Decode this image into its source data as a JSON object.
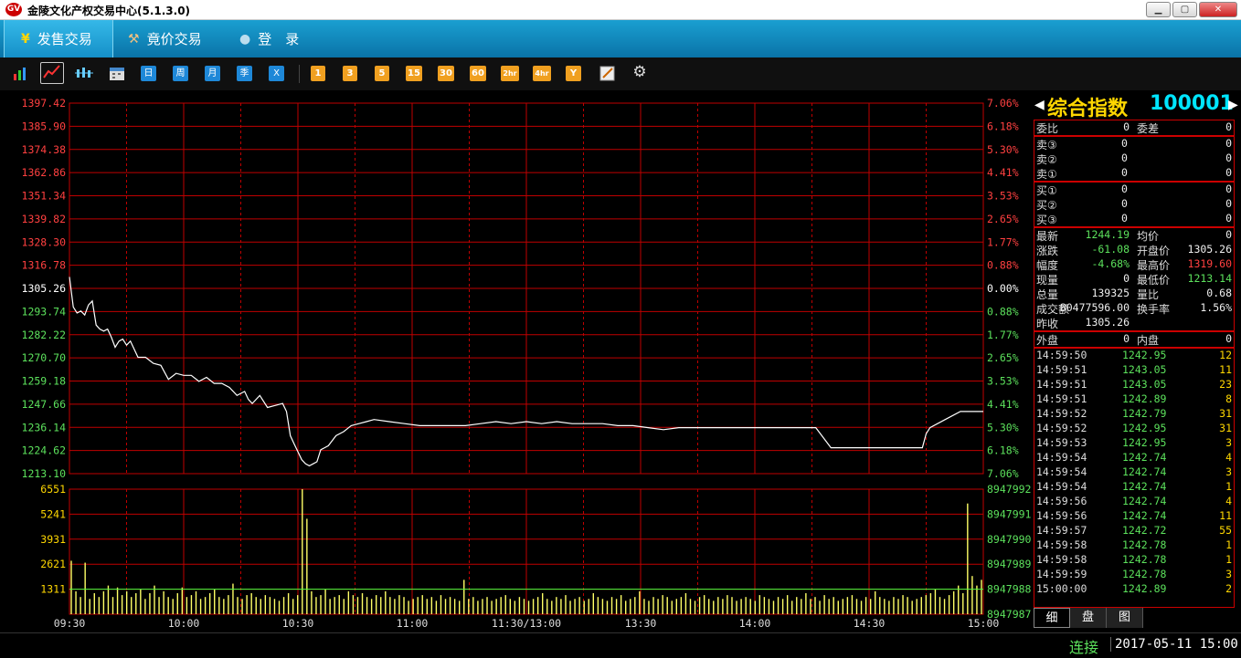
{
  "window": {
    "title": "金陵文化产权交易中心(5.1.3.0)",
    "logo": "GV"
  },
  "menu": {
    "tabs": [
      {
        "label": "发售交易",
        "icon": "yen-icon",
        "active": true
      },
      {
        "label": "竟价交易",
        "icon": "hammer-icon",
        "active": false
      },
      {
        "label": "登　录",
        "icon": "user-icon",
        "active": false
      }
    ]
  },
  "toolbar": {
    "periods_blue": [
      "日",
      "周",
      "月",
      "季",
      "X"
    ],
    "periods_min": [
      "1",
      "3",
      "5",
      "15",
      "30",
      "60",
      "2hr",
      "4hr",
      "Y"
    ]
  },
  "chart_data": {
    "type": "line",
    "title": "",
    "price_axis": {
      "left_labels": [
        "1397.42",
        "1385.90",
        "1374.38",
        "1362.86",
        "1351.34",
        "1339.82",
        "1328.30",
        "1316.78",
        "1305.26",
        "1293.74",
        "1282.22",
        "1270.70",
        "1259.18",
        "1247.66",
        "1236.14",
        "1224.62",
        "1213.10"
      ],
      "right_labels": [
        "7.06%",
        "6.18%",
        "5.30%",
        "4.41%",
        "3.53%",
        "2.65%",
        "1.77%",
        "0.88%",
        "0.00%",
        "0.88%",
        "1.77%",
        "2.65%",
        "3.53%",
        "4.41%",
        "5.30%",
        "6.18%",
        "7.06%"
      ],
      "ylim": [
        1213.1,
        1397.42
      ],
      "pre_close": 1305.26
    },
    "volume_axis": {
      "left_labels": [
        "6551",
        "5241",
        "3931",
        "2621",
        "1311"
      ],
      "right_labels": [
        "8947992",
        "8947991",
        "8947990",
        "8947989",
        "8947988",
        "8947987"
      ],
      "ylim": [
        0,
        6551
      ]
    },
    "x_labels": [
      "09:30",
      "10:00",
      "10:30",
      "11:00",
      "11:30/13:00",
      "13:30",
      "14:00",
      "14:30",
      "15:00"
    ],
    "x_range_minutes": [
      0,
      240
    ],
    "price_series": {
      "x": [
        0,
        1,
        2,
        3,
        4,
        5,
        6,
        7,
        8,
        9,
        10,
        11,
        12,
        13,
        14,
        15,
        16,
        18,
        20,
        22,
        24,
        26,
        28,
        30,
        32,
        34,
        36,
        38,
        40,
        42,
        44,
        46,
        47,
        48,
        50,
        52,
        54,
        56,
        57,
        58,
        59,
        60,
        61,
        62,
        63,
        64,
        65,
        66,
        67,
        68,
        70,
        72,
        74,
        76,
        78,
        80,
        84,
        88,
        92,
        96,
        100,
        104,
        108,
        112,
        116,
        120,
        124,
        128,
        132,
        136,
        140,
        144,
        148,
        152,
        156,
        160,
        164,
        168,
        172,
        176,
        180,
        184,
        188,
        192,
        196,
        200,
        204,
        208,
        212,
        216,
        220,
        224,
        225,
        226,
        230,
        234,
        236,
        238,
        239,
        240
      ],
      "y": [
        1311,
        1296,
        1293,
        1294,
        1292,
        1297,
        1299,
        1287,
        1285,
        1284,
        1285,
        1281,
        1276,
        1279,
        1280,
        1277,
        1279,
        1271,
        1271,
        1268,
        1267,
        1260,
        1263,
        1262,
        1262,
        1259,
        1261,
        1258,
        1258,
        1256,
        1252,
        1254,
        1250,
        1248,
        1252,
        1246,
        1247,
        1248,
        1244,
        1232,
        1228,
        1224,
        1220,
        1218,
        1217,
        1218,
        1219,
        1225,
        1226,
        1227,
        1232,
        1234,
        1237,
        1238,
        1239,
        1240,
        1239,
        1238,
        1237,
        1237,
        1237,
        1237,
        1238,
        1239,
        1238,
        1239,
        1238,
        1239,
        1238,
        1238,
        1238,
        1237,
        1237,
        1236,
        1235,
        1236,
        1236,
        1236,
        1236,
        1236,
        1236,
        1236,
        1236,
        1236,
        1236,
        1226,
        1226,
        1226,
        1226,
        1226,
        1226,
        1226,
        1233,
        1236,
        1240,
        1244,
        1244,
        1244,
        1244,
        1244
      ]
    },
    "volume_series": {
      "values": [
        2800,
        1200,
        900,
        2700,
        800,
        1100,
        900,
        1200,
        1500,
        900,
        1400,
        1000,
        1200,
        900,
        1100,
        1300,
        800,
        1100,
        1500,
        900,
        1200,
        900,
        800,
        1100,
        1400,
        900,
        1000,
        1200,
        800,
        900,
        1100,
        1300,
        900,
        800,
        1000,
        1600,
        900,
        800,
        1000,
        1100,
        900,
        800,
        1000,
        900,
        800,
        700,
        900,
        1100,
        800,
        1000,
        6551,
        5000,
        1200,
        900,
        1000,
        1300,
        800,
        900,
        1000,
        800,
        1200,
        1000,
        900,
        1100,
        900,
        800,
        1000,
        900,
        1200,
        900,
        800,
        1000,
        900,
        700,
        800,
        900,
        1000,
        800,
        900,
        700,
        1000,
        800,
        900,
        800,
        700,
        1800,
        800,
        900,
        700,
        800,
        900,
        700,
        800,
        900,
        1000,
        800,
        700,
        900,
        800,
        700,
        800,
        900,
        1100,
        800,
        700,
        900,
        800,
        1000,
        700,
        800,
        900,
        700,
        800,
        1100,
        900,
        800,
        700,
        900,
        800,
        1000,
        700,
        800,
        900,
        1200,
        800,
        700,
        900,
        800,
        1000,
        900,
        700,
        800,
        900,
        1100,
        800,
        700,
        900,
        1000,
        800,
        700,
        900,
        800,
        1000,
        900,
        700,
        800,
        900,
        800,
        700,
        1000,
        900,
        800,
        700,
        900,
        800,
        1000,
        700,
        900,
        800,
        1100,
        800,
        900,
        700,
        1000,
        800,
        900,
        700,
        800,
        900,
        1000,
        800,
        700,
        900,
        800,
        1200,
        900,
        800,
        700,
        900,
        800,
        1000,
        900,
        700,
        800,
        900,
        1000,
        1100,
        1300,
        900,
        800,
        1000,
        1200,
        1500,
        1100,
        5800,
        2000,
        1500,
        1800
      ]
    },
    "avg_line_value": 1311
  },
  "panel": {
    "name": "综合指数",
    "code": "100001",
    "order_ratio": {
      "label1": "委比",
      "v1": "0",
      "label2": "委差",
      "v2": "0"
    },
    "sell": [
      {
        "label": "卖③",
        "price": "0",
        "vol": "0"
      },
      {
        "label": "卖②",
        "price": "0",
        "vol": "0"
      },
      {
        "label": "卖①",
        "price": "0",
        "vol": "0"
      }
    ],
    "buy": [
      {
        "label": "买①",
        "price": "0",
        "vol": "0"
      },
      {
        "label": "买②",
        "price": "0",
        "vol": "0"
      },
      {
        "label": "买③",
        "price": "0",
        "vol": "0"
      }
    ],
    "quote": [
      {
        "l1": "最新",
        "v1": "1244.19",
        "c1": "c-green",
        "l2": "均价",
        "v2": "0",
        "c2": "c-white"
      },
      {
        "l1": "涨跌",
        "v1": "-61.08",
        "c1": "c-green",
        "l2": "开盘价",
        "v2": "1305.26",
        "c2": "c-white"
      },
      {
        "l1": "幅度",
        "v1": "-4.68%",
        "c1": "c-green",
        "l2": "最高价",
        "v2": "1319.60",
        "c2": "c-red"
      },
      {
        "l1": "现量",
        "v1": "0",
        "c1": "c-white",
        "l2": "最低价",
        "v2": "1213.14",
        "c2": "c-green"
      },
      {
        "l1": "总量",
        "v1": "139325",
        "c1": "c-white",
        "l2": "量比",
        "v2": "0.68",
        "c2": "c-white"
      },
      {
        "l1": "成交额",
        "v1": "80477596.00",
        "c1": "c-white",
        "l2": "换手率",
        "v2": "1.56%",
        "c2": "c-white"
      },
      {
        "l1": "昨收",
        "v1": "1305.26",
        "c1": "c-white",
        "l2": "",
        "v2": "",
        "c2": "c-white"
      }
    ],
    "outer_inner": {
      "l1": "外盘",
      "v1": "0",
      "l2": "内盘",
      "v2": "0"
    },
    "ticks": [
      {
        "time": "14:59:50",
        "price": "1242.95",
        "vol": "12"
      },
      {
        "time": "14:59:51",
        "price": "1243.05",
        "vol": "11"
      },
      {
        "time": "14:59:51",
        "price": "1243.05",
        "vol": "23"
      },
      {
        "time": "14:59:51",
        "price": "1242.89",
        "vol": "8"
      },
      {
        "time": "14:59:52",
        "price": "1242.79",
        "vol": "31"
      },
      {
        "time": "14:59:52",
        "price": "1242.95",
        "vol": "31"
      },
      {
        "time": "14:59:53",
        "price": "1242.95",
        "vol": "3"
      },
      {
        "time": "14:59:54",
        "price": "1242.74",
        "vol": "4"
      },
      {
        "time": "14:59:54",
        "price": "1242.74",
        "vol": "3"
      },
      {
        "time": "14:59:54",
        "price": "1242.74",
        "vol": "1"
      },
      {
        "time": "14:59:56",
        "price": "1242.74",
        "vol": "4"
      },
      {
        "time": "14:59:56",
        "price": "1242.74",
        "vol": "11"
      },
      {
        "time": "14:59:57",
        "price": "1242.72",
        "vol": "55"
      },
      {
        "time": "14:59:58",
        "price": "1242.78",
        "vol": "1"
      },
      {
        "time": "14:59:58",
        "price": "1242.78",
        "vol": "1"
      },
      {
        "time": "14:59:59",
        "price": "1242.78",
        "vol": "3"
      },
      {
        "time": "15:00:00",
        "price": "1242.89",
        "vol": "2"
      }
    ],
    "tabs": [
      "细",
      "盘",
      "图"
    ]
  },
  "status": {
    "connection": "连接",
    "datetime": "2017-05-11 15:00"
  },
  "colors": {
    "grid": "#c00000",
    "price_line": "#ffffff",
    "volume_bar": "#ffff66",
    "avg_line": "#40ff40",
    "label_up": "#ff4040",
    "label_down": "#5ce15c"
  }
}
